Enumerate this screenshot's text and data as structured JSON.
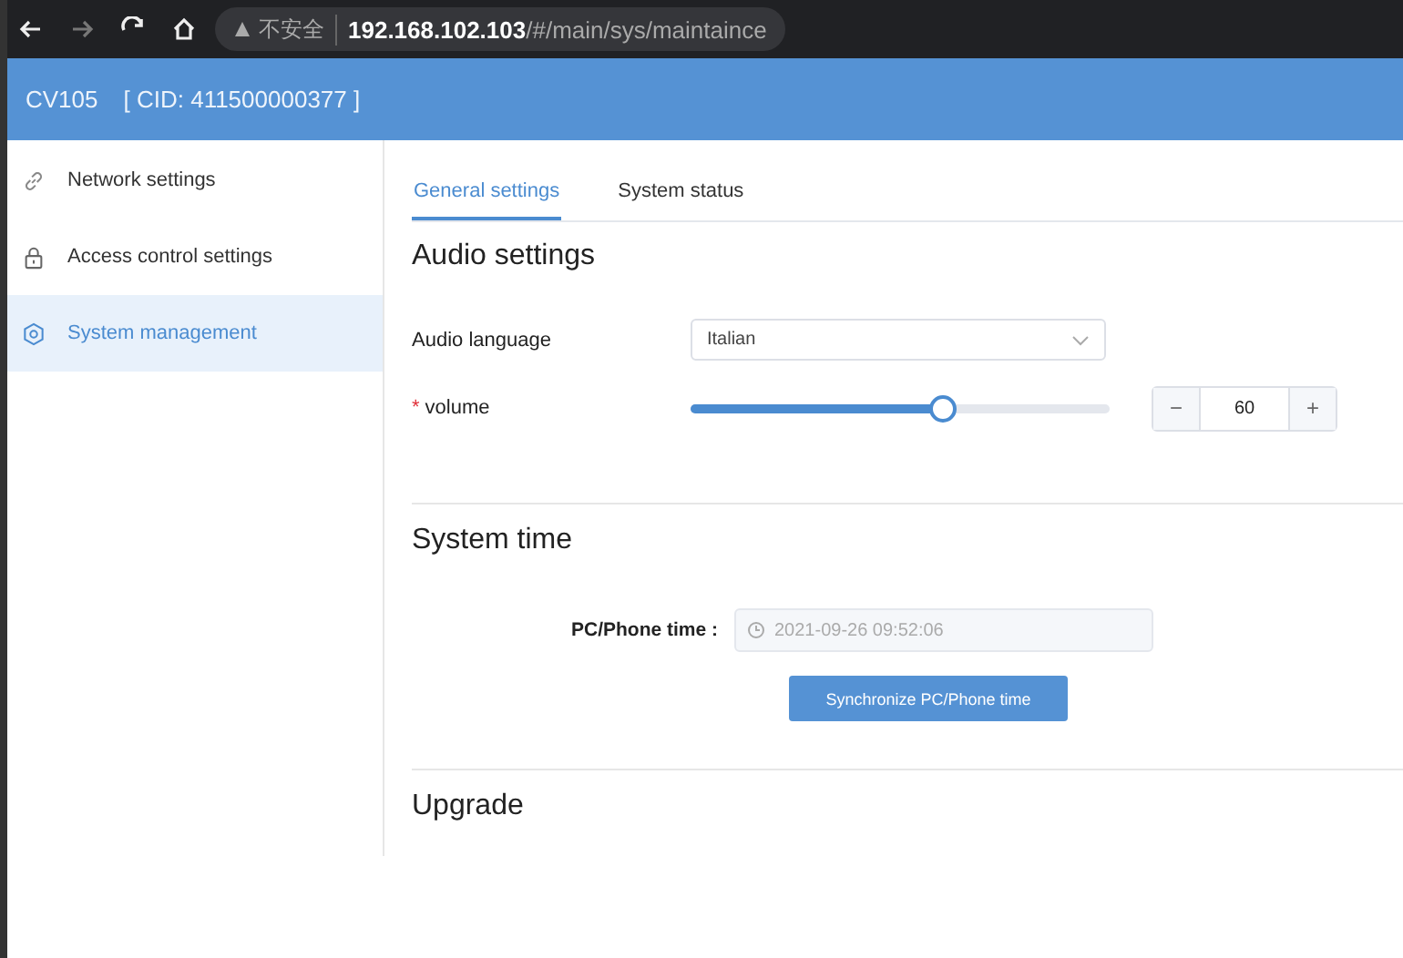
{
  "browser": {
    "security_label": "不安全",
    "url_host": "192.168.102.103",
    "url_path": "/#/main/sys/maintaince"
  },
  "header": {
    "device": "CV105",
    "cid": "[ CID: 411500000377 ]"
  },
  "sidebar": {
    "items": [
      {
        "label": "Network settings",
        "kind": "link",
        "selected": false
      },
      {
        "label": "Access control settings",
        "kind": "lock",
        "selected": false
      },
      {
        "label": "System management",
        "kind": "gear",
        "selected": true
      }
    ]
  },
  "tabs": [
    {
      "label": "General settings",
      "selected": true
    },
    {
      "label": "System status",
      "selected": false
    }
  ],
  "audio": {
    "title": "Audio settings",
    "language_label": "Audio language",
    "language_value": "Italian",
    "volume_label": "volume",
    "required_mark": "*",
    "level": 0.6,
    "volume_value": "60",
    "minus": "−",
    "plus": "+"
  },
  "time": {
    "title": "System time",
    "label": "PC/Phone time :",
    "value": "2021-09-26 09:52:06",
    "disabled": true,
    "button": "Synchronize PC/Phone time"
  },
  "upgrade": {
    "title": "Upgrade"
  }
}
